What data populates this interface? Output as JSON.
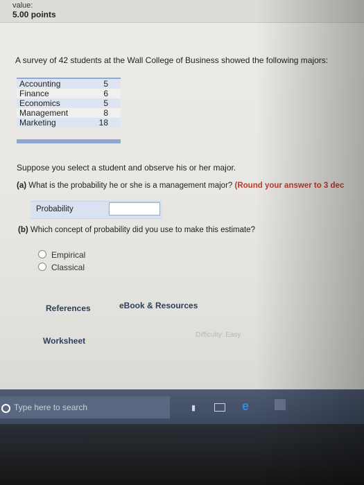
{
  "header": {
    "value_label": "value:",
    "points": "5.00 points"
  },
  "question": {
    "intro": "A survey of 42 students at the Wall College of Business showed the following majors:",
    "majors": [
      {
        "name": "Accounting",
        "count": "5"
      },
      {
        "name": "Finance",
        "count": "6"
      },
      {
        "name": "Economics",
        "count": "5"
      },
      {
        "name": "Management",
        "count": "8"
      },
      {
        "name": "Marketing",
        "count": "18"
      }
    ],
    "suppose": "Suppose you select a student and observe his or her major.",
    "part_a_label": "(a)",
    "part_a_text": "What is the probability he or she is a management major?",
    "part_a_round": "(Round your answer to 3 dec",
    "probability_label": "Probability",
    "probability_value": "",
    "part_b_label": "(b)",
    "part_b_text": "Which concept of probability did you use to make this estimate?",
    "options": [
      "Empirical",
      "Classical"
    ]
  },
  "links": {
    "references": "References",
    "ebook": "eBook & Resources",
    "worksheet": "Worksheet",
    "difficulty": "Difficulty: Easy"
  },
  "taskbar": {
    "search_placeholder": "Type here to search",
    "edge_glyph": "e"
  }
}
